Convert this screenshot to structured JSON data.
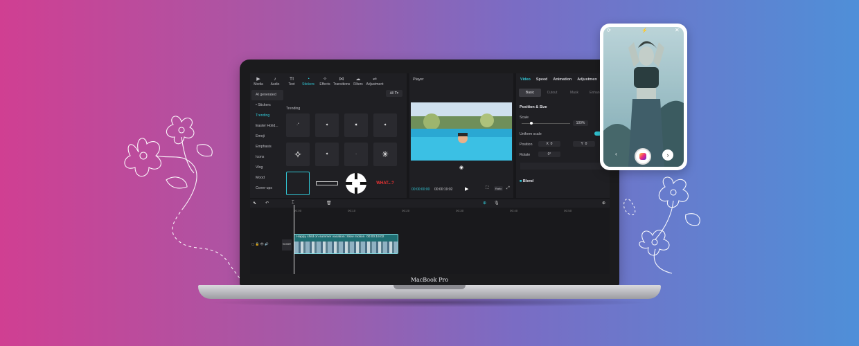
{
  "laptop": {
    "model_label": "MacBook Pro"
  },
  "editor": {
    "toolbar": [
      {
        "icon": "media-icon",
        "label": "Media"
      },
      {
        "icon": "audio-icon",
        "label": "Audio"
      },
      {
        "icon": "text-icon",
        "label": "Text"
      },
      {
        "icon": "stickers-icon",
        "label": "Stickers"
      },
      {
        "icon": "effects-icon",
        "label": "Effects"
      },
      {
        "icon": "transitions-icon",
        "label": "Transitions"
      },
      {
        "icon": "filters-icon",
        "label": "Filters"
      },
      {
        "icon": "adjustment-icon",
        "label": "Adjustment"
      }
    ],
    "active_tool": "Stickers",
    "sidebar": {
      "items": [
        "AI generated",
        "• Stickers",
        "Trending",
        "Easter Holid...",
        "Emoji",
        "Emphasis",
        "Icons",
        "Vlog",
        "Mood",
        "Cover-ups"
      ]
    },
    "stickers": {
      "all_label": "All",
      "section_title": "Trending",
      "what_sticker": "WHAT...?"
    },
    "player": {
      "title": "Player",
      "time_current": "00:00:00:00",
      "time_total": "00:00:19:02",
      "ratio_label": "Ratio"
    },
    "properties": {
      "tabs": [
        "Video",
        "Speed",
        "Animation",
        "Adjustmen"
      ],
      "active_tab": "Video",
      "sub_tabs": [
        "Basic",
        "Cutout",
        "Mask",
        "Enhance"
      ],
      "active_sub_tab": "Basic",
      "section_position": "Position & Size",
      "scale_label": "Scale",
      "scale_value": "100%",
      "uniform_scale_label": "Uniform scale",
      "position_label": "Position",
      "position_x_axis": "X",
      "position_x": "0",
      "position_y_axis": "Y",
      "position_y": "0",
      "rotate_label": "Rotate",
      "rotate_value": "0°",
      "blend_label": "Blend"
    },
    "timeline": {
      "ticks": [
        "00:00",
        "00:10",
        "00:20",
        "00:30",
        "00:40",
        "00:50"
      ],
      "clip_title": "Happy child on summer vacation: Slow motion",
      "clip_duration": "00:00:19:02",
      "cover_label": "Cover"
    }
  },
  "colors": {
    "accent": "#31c6d4",
    "bg_left": "#d03f92",
    "bg_right": "#4f8fd8"
  }
}
